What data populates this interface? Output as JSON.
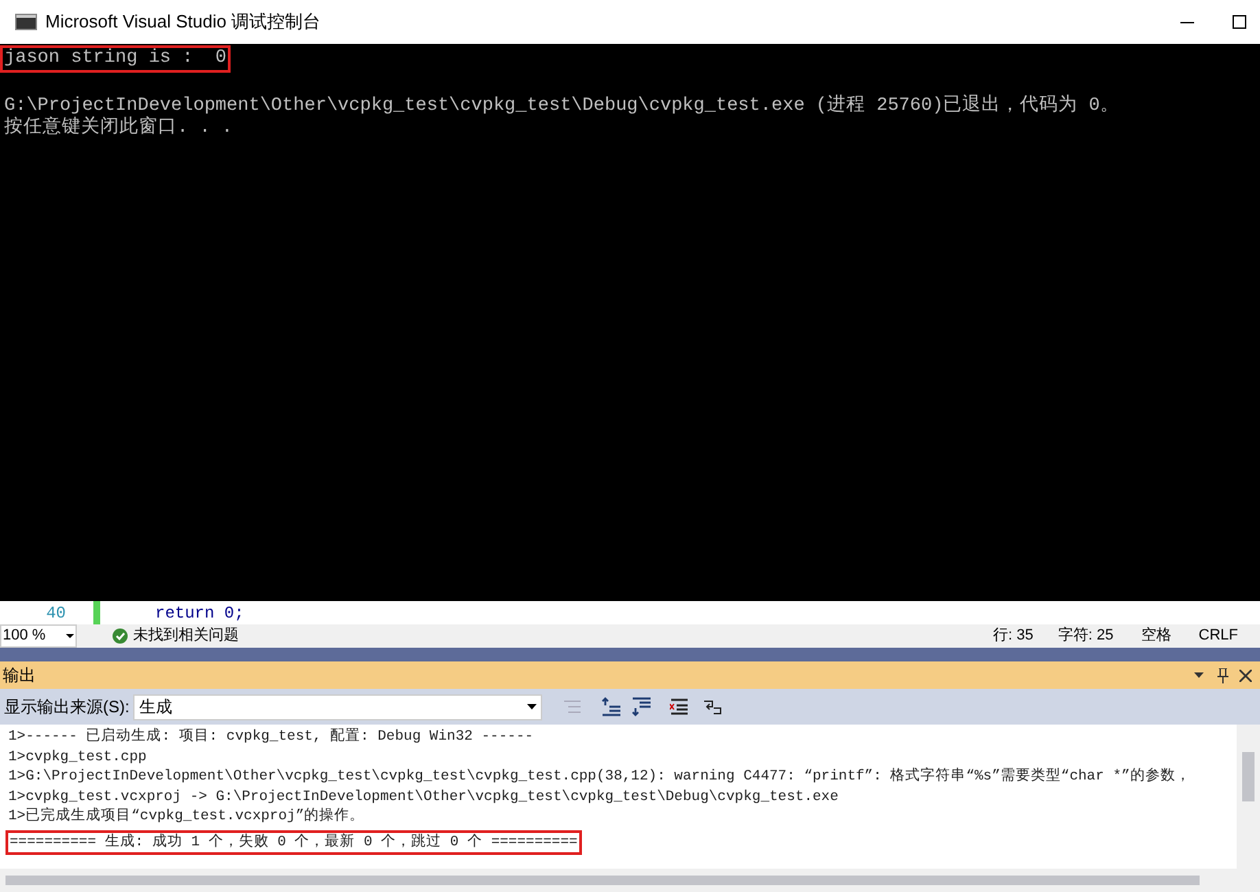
{
  "window": {
    "title": "Microsoft Visual Studio 调试控制台"
  },
  "console": {
    "lines": [
      {
        "text": "jason string is :  0",
        "highlighted": true
      },
      {
        "text": "G:\\ProjectInDevelopment\\Other\\vcpkg_test\\cvpkg_test\\Debug\\cvpkg_test.exe (进程 25760)已退出，代码为 0。",
        "highlighted": false
      },
      {
        "text": "按任意键关闭此窗口. . .",
        "highlighted": false
      }
    ]
  },
  "editor": {
    "line_number": "40",
    "code": "return 0;"
  },
  "status_bar": {
    "zoom": "100 %",
    "issues": "未找到相关问题",
    "line": "行: 35",
    "char": "字符: 25",
    "spacing": "空格",
    "line_ending": "CRLF"
  },
  "output": {
    "title": "输出",
    "source_label": "显示输出来源(S):",
    "source": "生成",
    "lines": [
      {
        "text": "1>------ 已启动生成: 项目: cvpkg_test, 配置: Debug Win32 ------",
        "highlighted": false
      },
      {
        "text": "1>cvpkg_test.cpp",
        "highlighted": false
      },
      {
        "text": "1>G:\\ProjectInDevelopment\\Other\\vcpkg_test\\cvpkg_test\\cvpkg_test.cpp(38,12): warning C4477: “printf”: 格式字符串“%s”需要类型“char *”的参数，",
        "highlighted": false
      },
      {
        "text": "1>cvpkg_test.vcxproj -> G:\\ProjectInDevelopment\\Other\\vcpkg_test\\cvpkg_test\\Debug\\cvpkg_test.exe",
        "highlighted": false
      },
      {
        "text": "1>已完成生成项目“cvpkg_test.vcxproj”的操作。",
        "highlighted": false
      },
      {
        "text": "========== 生成: 成功 1 个，失败 0 个，最新 0 个，跳过 0 个 ==========",
        "highlighted": true
      }
    ]
  }
}
